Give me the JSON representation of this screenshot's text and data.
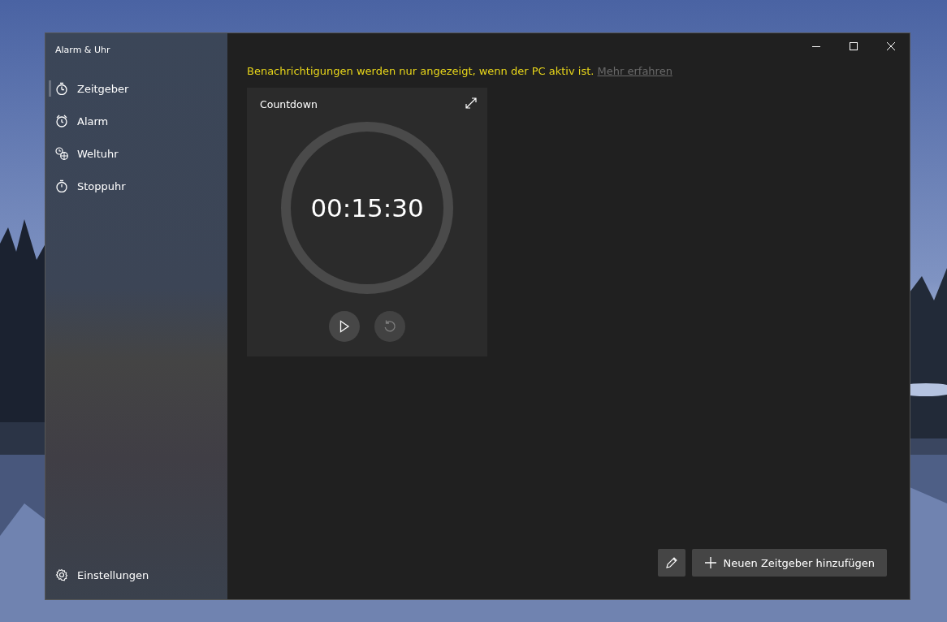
{
  "window": {
    "title": "Alarm & Uhr"
  },
  "sidebar": {
    "items": [
      {
        "label": "Zeitgeber",
        "selected": true
      },
      {
        "label": "Alarm",
        "selected": false
      },
      {
        "label": "Weltuhr",
        "selected": false
      },
      {
        "label": "Stoppuhr",
        "selected": false
      }
    ],
    "settings": {
      "label": "Einstellungen"
    }
  },
  "notice": {
    "text": "Benachrichtigungen werden nur angezeigt, wenn der PC aktiv ist.",
    "link": "Mehr erfahren"
  },
  "timers": [
    {
      "title": "Countdown",
      "time": "00:15:30",
      "controls": [
        {
          "kind": "play",
          "disabled": false
        },
        {
          "kind": "reset",
          "disabled": true
        }
      ]
    }
  ],
  "footer": {
    "add_button": "Neuen Zeitgeber hinzufügen"
  }
}
